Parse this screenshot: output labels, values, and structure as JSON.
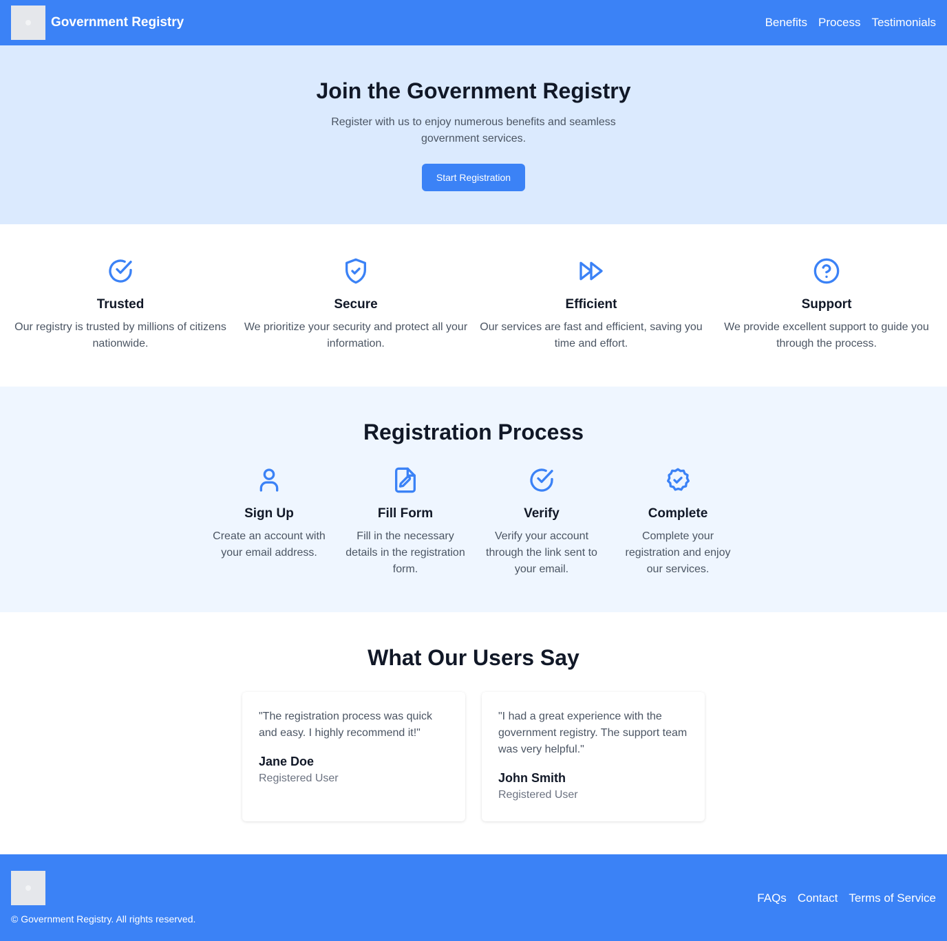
{
  "header": {
    "brand": "Government Registry",
    "nav": [
      "Benefits",
      "Process",
      "Testimonials"
    ]
  },
  "hero": {
    "title": "Join the Government Registry",
    "subtitle": "Register with us to enjoy numerous benefits and seamless government services.",
    "cta": "Start Registration"
  },
  "benefits": [
    {
      "icon": "check-circle-icon",
      "title": "Trusted",
      "text": "Our registry is trusted by millions of citizens nationwide."
    },
    {
      "icon": "shield-check-icon",
      "title": "Secure",
      "text": "We prioritize your security and protect all your information."
    },
    {
      "icon": "fast-forward-icon",
      "title": "Efficient",
      "text": "Our services are fast and efficient, saving you time and effort."
    },
    {
      "icon": "question-circle-icon",
      "title": "Support",
      "text": "We provide excellent support to guide you through the process."
    }
  ],
  "process": {
    "title": "Registration Process",
    "steps": [
      {
        "icon": "user-icon",
        "title": "Sign Up",
        "text": "Create an account with your email address."
      },
      {
        "icon": "file-edit-icon",
        "title": "Fill Form",
        "text": "Fill in the necessary details in the registration form."
      },
      {
        "icon": "check-circle-icon",
        "title": "Verify",
        "text": "Verify your account through the link sent to your email."
      },
      {
        "icon": "badge-check-icon",
        "title": "Complete",
        "text": "Complete your registration and enjoy our services."
      }
    ]
  },
  "testimonials": {
    "title": "What Our Users Say",
    "items": [
      {
        "quote": "\"The registration process was quick and easy. I highly recommend it!\"",
        "name": "Jane Doe",
        "role": "Registered User"
      },
      {
        "quote": "\"I had a great experience with the government registry. The support team was very helpful.\"",
        "name": "John Smith",
        "role": "Registered User"
      }
    ]
  },
  "footer": {
    "copyright": "© Government Registry. All rights reserved.",
    "links": [
      "FAQs",
      "Contact",
      "Terms of Service"
    ]
  },
  "colors": {
    "primary": "#3b82f6",
    "hero_bg": "#dbeafe",
    "process_bg": "#eff6ff"
  }
}
